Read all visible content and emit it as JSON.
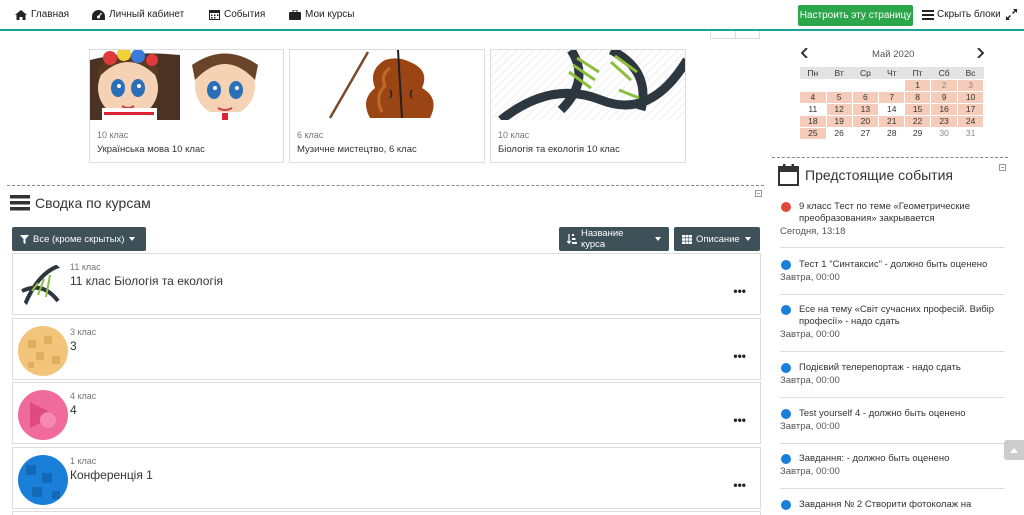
{
  "nav": {
    "home": "Главная",
    "dashboard": "Личный кабинет",
    "events": "События",
    "my_courses": "Мои курсы",
    "customize": "Настроить эту страницу",
    "hide_blocks": "Скрыть блоки"
  },
  "recent_courses": [
    {
      "category": "10 клас",
      "name": "Українська мова 10 клас"
    },
    {
      "category": "6 клас",
      "name": "Музичне мистецтво, 6 клас"
    },
    {
      "category": "10 клас",
      "name": "Біологія та екологія 10 клас"
    }
  ],
  "overview": {
    "title": "Сводка по курсам",
    "filter": "Все (кроме скрытых)",
    "sort": "Название курса",
    "view": "Описание",
    "menu": "•••",
    "courses": [
      {
        "category": "11 клас",
        "name": "11 клас Біологія та екологія",
        "color": "#ffffff"
      },
      {
        "category": "3 клас",
        "name": "3",
        "color": "#f2c57a"
      },
      {
        "category": "4 клас",
        "name": "4",
        "color": "#f06a9a"
      },
      {
        "category": "1 клас",
        "name": "Конференція 1",
        "color": "#1a7fd8"
      }
    ]
  },
  "calendar": {
    "prev": "◀",
    "next": "▶",
    "month": "Май 2020",
    "weekdays": [
      "Пн",
      "Вт",
      "Ср",
      "Чт",
      "Пт",
      "Сб",
      "Вс"
    ],
    "weeks": [
      [
        "",
        "",
        "",
        "",
        "1",
        "2",
        "3"
      ],
      [
        "4",
        "5",
        "6",
        "7",
        "8",
        "9",
        "10"
      ],
      [
        "11",
        "12",
        "13",
        "14",
        "15",
        "16",
        "17"
      ],
      [
        "18",
        "19",
        "20",
        "21",
        "22",
        "23",
        "24"
      ],
      [
        "25",
        "26",
        "27",
        "28",
        "29",
        "30",
        "31"
      ]
    ]
  },
  "upcoming": {
    "title": "Предстоящие события",
    "events": [
      {
        "name": "9 класс Тест по теме «Геометрические преобразования» закрывается",
        "time": "Сегодня, 13:18",
        "color": "#e0473b"
      },
      {
        "name": "Тест 1 \"Синтаксис\" - должно быть оценено",
        "time": "Завтра, 00:00",
        "color": "#1a7fd8"
      },
      {
        "name": "Есе на тему «Світ сучасних професій. Вибір професії» - надо сдать",
        "time": "Завтра, 00:00",
        "color": "#1a7fd8"
      },
      {
        "name": "Подієвий телерепортаж - надо сдать",
        "time": "Завтра, 00:00",
        "color": "#1a7fd8"
      },
      {
        "name": "Test yourself 4 - должно быть оценено",
        "time": "Завтра, 00:00",
        "color": "#1a7fd8"
      },
      {
        "name": "Завдання: - должно быть оценено",
        "time": "Завтра, 00:00",
        "color": "#1a7fd8"
      },
      {
        "name": "Завдання № 2 Створити фотоколаж на",
        "time": "",
        "color": "#1a7fd8"
      }
    ]
  },
  "colors": {
    "accent": "#1aa39b",
    "customize_btn": "#2ca64b",
    "dark_btn": "#3e5058"
  }
}
